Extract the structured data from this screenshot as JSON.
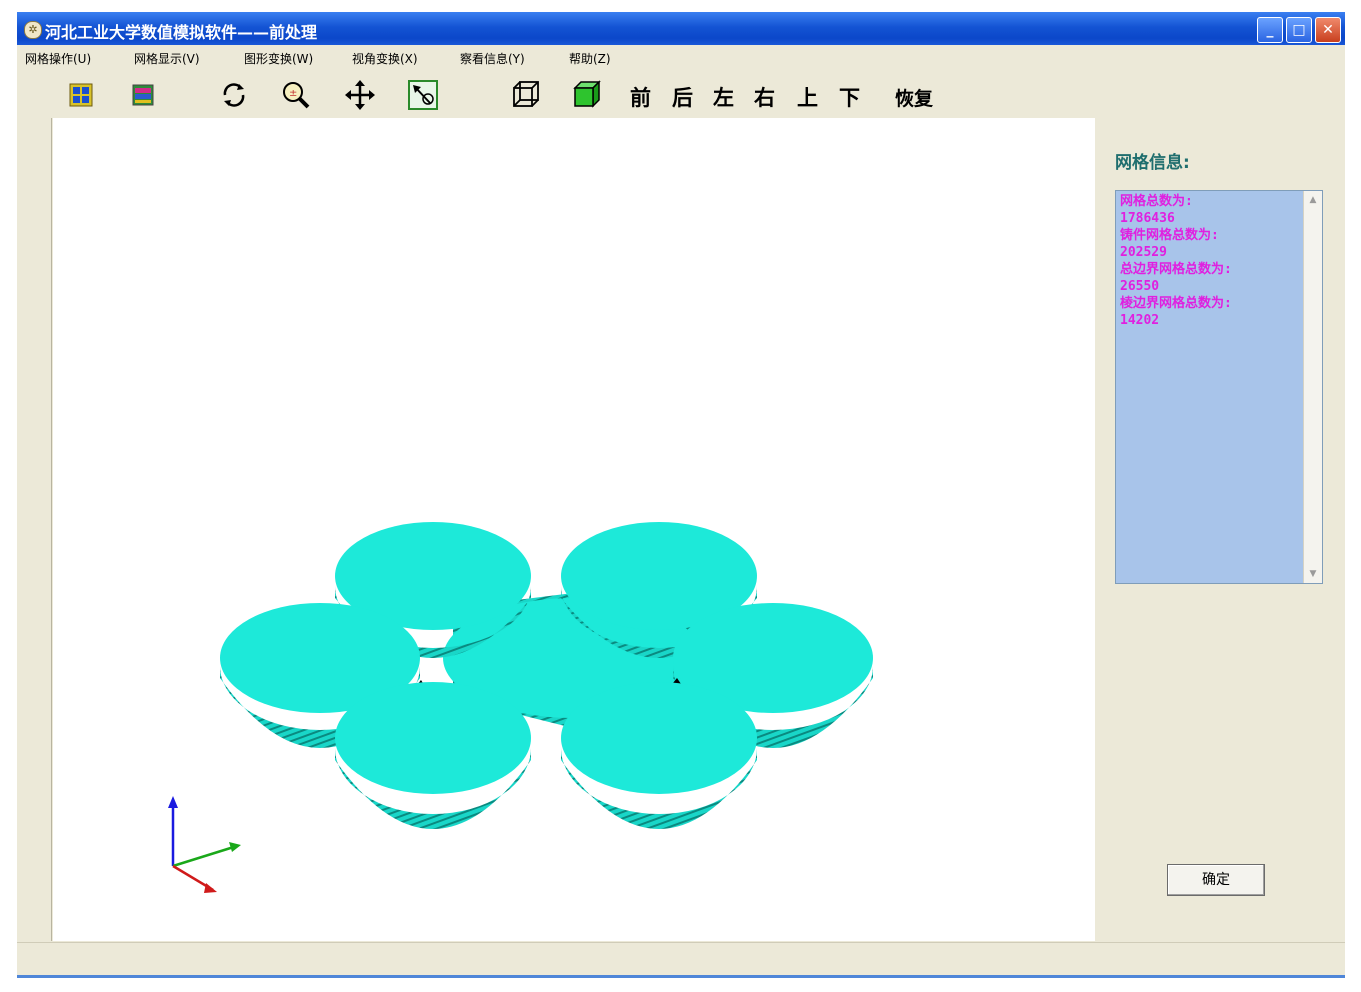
{
  "window": {
    "title": "河北工业大学数值模拟软件——前处理",
    "controls": {
      "minimize": "_",
      "maximize": "□",
      "close": "✕"
    }
  },
  "menubar": {
    "items": [
      {
        "label": "网格操作(U)"
      },
      {
        "label": "网格显示(V)"
      },
      {
        "label": "图形变换(W)"
      },
      {
        "label": "视角变换(X)"
      },
      {
        "label": "察看信息(Y)"
      },
      {
        "label": "帮助(Z)"
      }
    ]
  },
  "toolbar": {
    "icons": [
      "grid-show-icon",
      "mesh-color-icon",
      "rotate-icon",
      "zoom-icon",
      "pan-icon",
      "select-icon",
      "wireframe-cube-icon",
      "solid-cube-icon"
    ],
    "views": [
      "前",
      "后",
      "左",
      "右",
      "上",
      "下"
    ],
    "restore": "恢复"
  },
  "info_panel": {
    "label": "网格信息:",
    "lines": [
      "网格总数为:",
      "1786436",
      "铸件网格总数为:",
      "202529",
      "总边界网格总数为:",
      "26550",
      "棱边界网格总数为:",
      "14202"
    ],
    "ok_button": "确定"
  },
  "model": {
    "color": "#1de9d9",
    "shadow_color": "#0fb5a8",
    "axes_colors": {
      "z": "#1a1ae0",
      "y": "#1aa81a",
      "x": "#d01a1a"
    }
  }
}
